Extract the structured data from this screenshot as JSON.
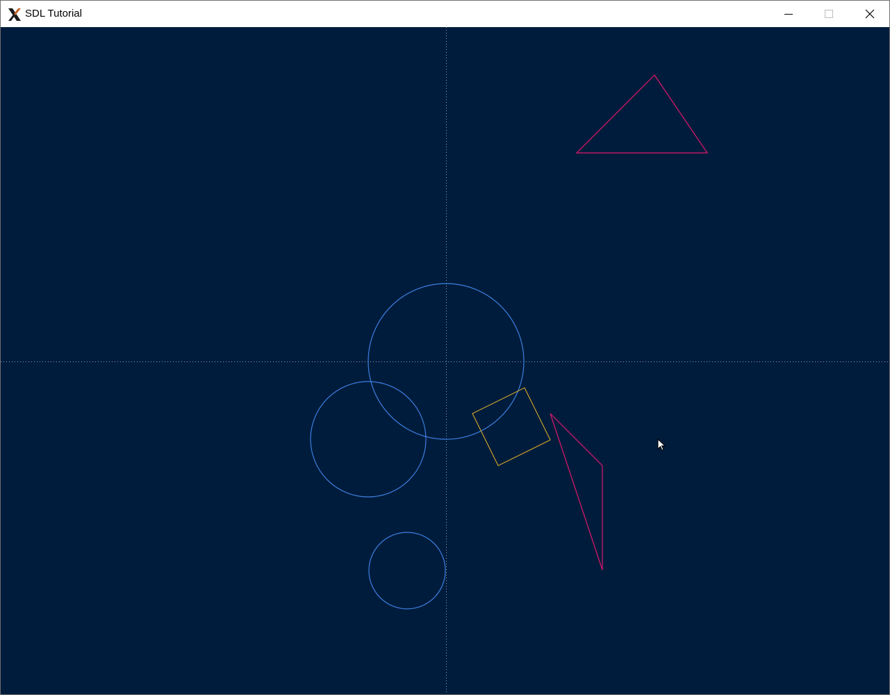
{
  "window": {
    "title": "SDL Tutorial",
    "icon": "x-logo-icon"
  },
  "controls": {
    "minimize": "minimize-icon",
    "maximize": "maximize-icon",
    "close": "close-icon"
  },
  "canvas": {
    "background": "#001c3c",
    "axis_color": "#8fa8c4",
    "circle_color": "#3d7fe0",
    "square_color": "#c9a227",
    "triangle_color": "#e0176e",
    "cursor": "arrow-pointer-icon"
  }
}
